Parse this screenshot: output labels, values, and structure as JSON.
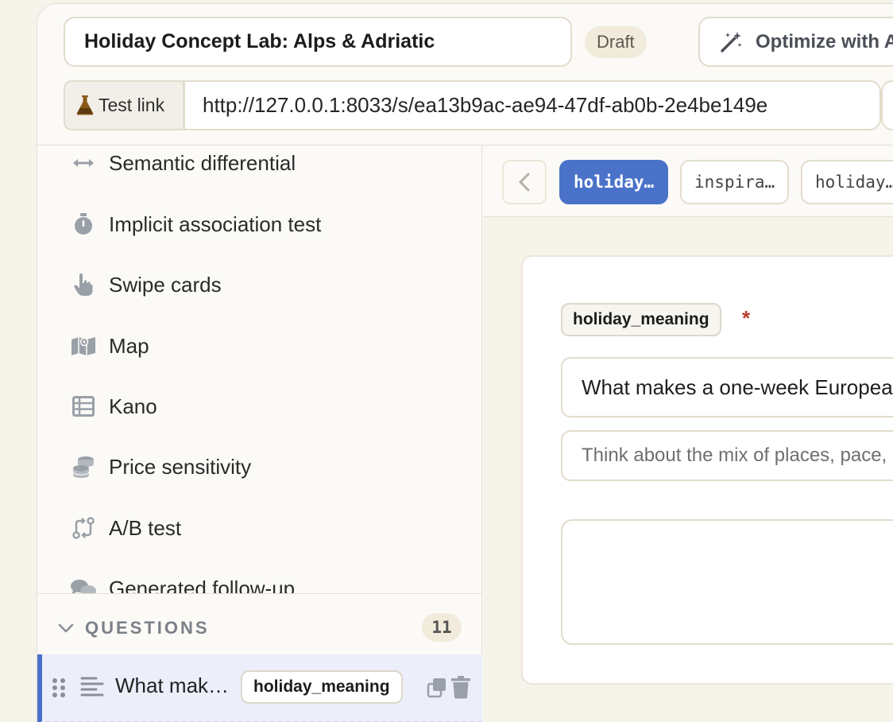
{
  "header": {
    "survey_title": "Holiday Concept Lab: Alps & Adriatic",
    "status_badge": "Draft",
    "optimize_label": "Optimize with AI",
    "test_link_label": "Test link",
    "test_url": "http://127.0.0.1:8033/s/ea13b9ac-ae94-47df-ab0b-2e4be149e"
  },
  "question_types": [
    {
      "label": "Semantic differential",
      "icon": "arrows-horizontal-icon"
    },
    {
      "label": "Implicit association test",
      "icon": "stopwatch-icon"
    },
    {
      "label": "Swipe cards",
      "icon": "pointer-hand-icon"
    },
    {
      "label": "Map",
      "icon": "map-icon"
    },
    {
      "label": "Kano",
      "icon": "table-icon"
    },
    {
      "label": "Price sensitivity",
      "icon": "coins-icon"
    },
    {
      "label": "A/B test",
      "icon": "swap-icon"
    },
    {
      "label": "Generated follow-up",
      "icon": "chat-bubbles-icon"
    }
  ],
  "questions_section": {
    "heading": "QUESTIONS",
    "count": "11",
    "items": [
      {
        "text": "What mak…",
        "tag": "holiday_meaning"
      }
    ]
  },
  "tabs": [
    {
      "label": "holiday…",
      "active": true
    },
    {
      "label": "inspira…",
      "active": false
    },
    {
      "label": "holiday…",
      "active": false
    }
  ],
  "editor": {
    "variable_tag": "holiday_meaning",
    "required_marker": "*",
    "question_text": "What makes a one-week European holiday feel meaningful to you?",
    "description_text": "Think about the mix of places, pace, and people you travel with."
  },
  "colors": {
    "accent": "#4a72c9",
    "required": "#c0392b",
    "background": "#f6f3eb"
  }
}
